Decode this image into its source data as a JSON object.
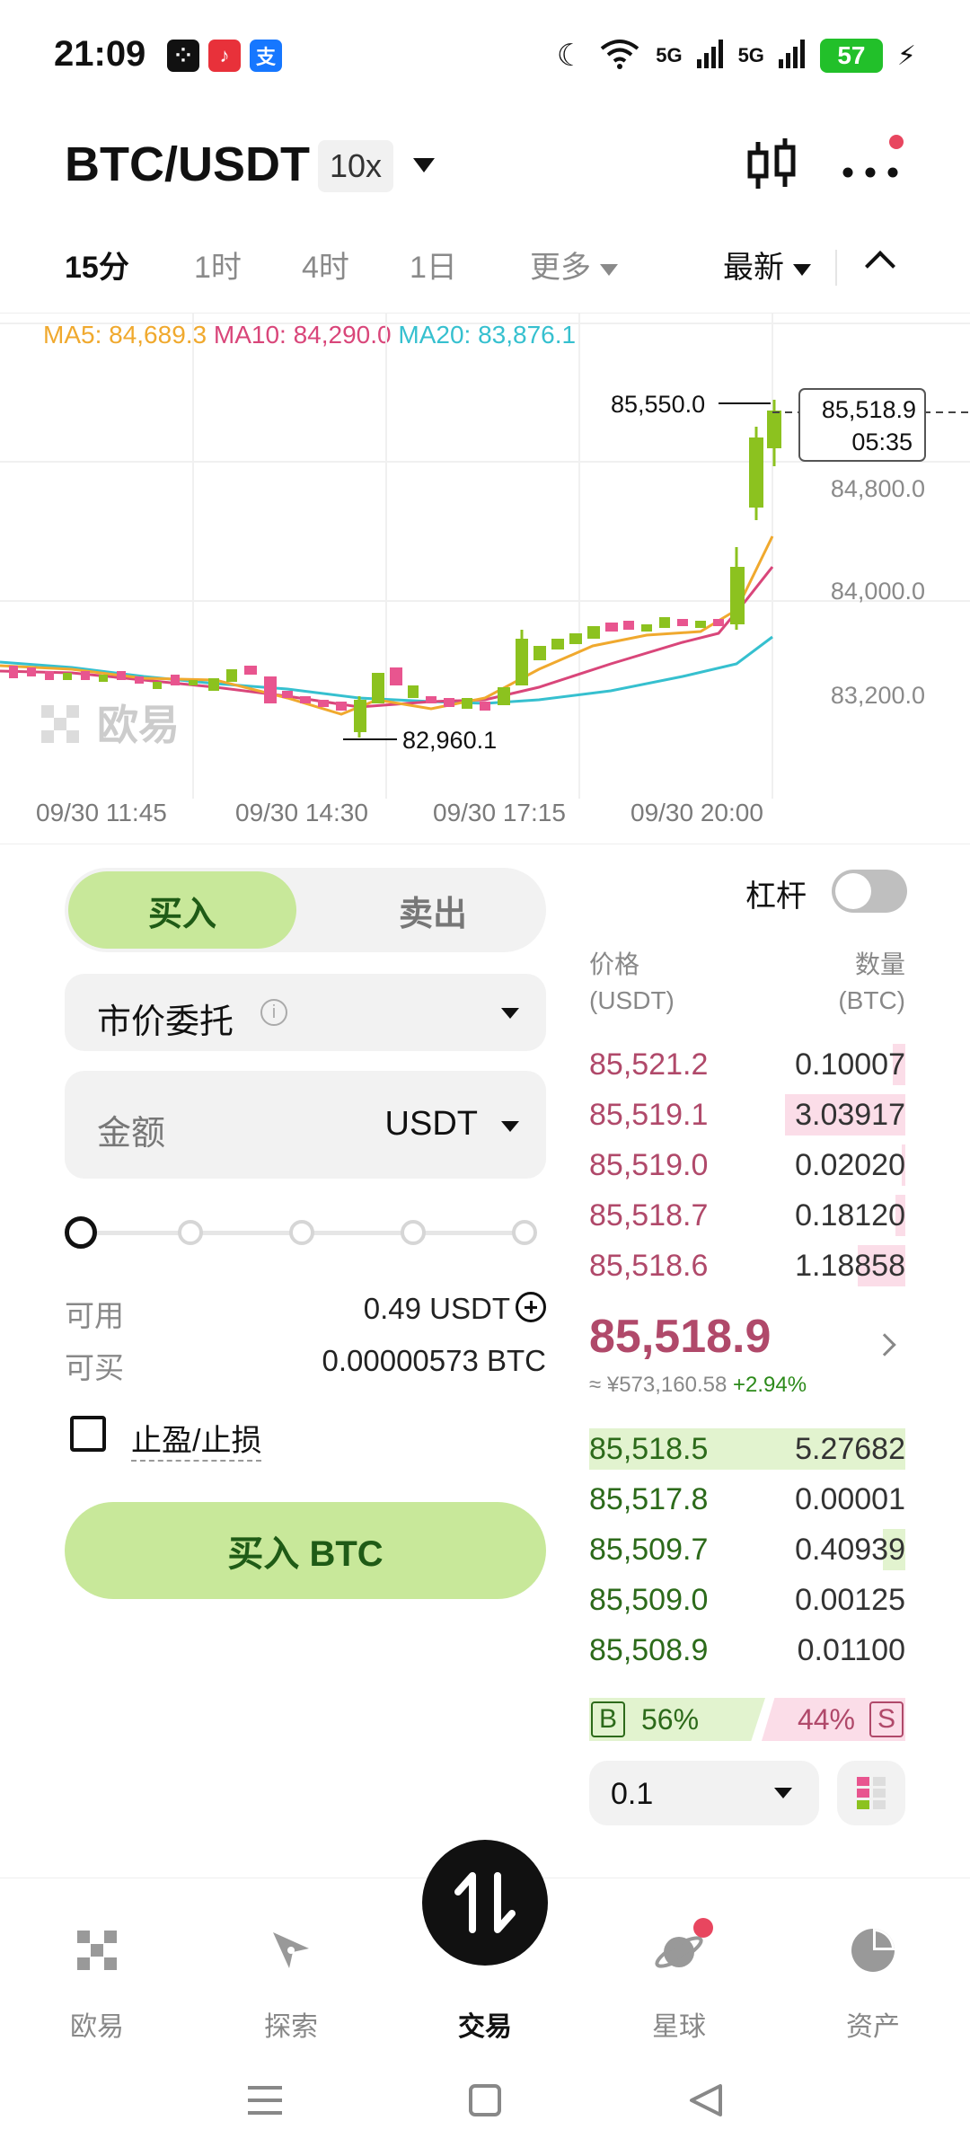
{
  "status_bar": {
    "time": "21:09",
    "battery": "57",
    "signal_1": "5G",
    "signal_2": "5G"
  },
  "header": {
    "pair": "BTC/USDT",
    "leverage": "10x"
  },
  "interval_tabs": [
    {
      "label": "15分",
      "active": true
    },
    {
      "label": "1时",
      "active": false
    },
    {
      "label": "4时",
      "active": false
    },
    {
      "label": "1日",
      "active": false
    },
    {
      "label": "更多",
      "active": false
    }
  ],
  "sort_label": "最新",
  "chart": {
    "ma5": "MA5: 84,689.3",
    "ma10": "MA10: 84,290.0",
    "ma20": "MA20: 83,876.1",
    "high_label": "85,550.0",
    "low_label": "82,960.1",
    "current_price": "85,518.9",
    "countdown": "05:35",
    "y_ticks": [
      "84,800.0",
      "84,000.0",
      "83,200.0"
    ],
    "x_ticks": [
      "09/30 11:45",
      "09/30 14:30",
      "09/30 17:15",
      "09/30 20:00"
    ],
    "watermark": "欧易",
    "colors": {
      "up": "#8cc21f",
      "down": "#e8558f"
    }
  },
  "chart_data": {
    "type": "candlestick",
    "series": [
      {
        "name": "MA5",
        "value": 84689.3
      },
      {
        "name": "MA10",
        "value": 84290.0
      },
      {
        "name": "MA20",
        "value": 83876.1
      }
    ],
    "high": 85550.0,
    "low": 82960.1,
    "last": 85518.9,
    "y_ticks": [
      84800.0,
      84000.0,
      83200.0
    ],
    "x_ticks": [
      "09/30 11:45",
      "09/30 14:30",
      "09/30 17:15",
      "09/30 20:00"
    ]
  },
  "trade": {
    "buy_tab": "买入",
    "sell_tab": "卖出",
    "order_type": "市价委托",
    "amount_placeholder": "金额",
    "amount_currency": "USDT",
    "available_label": "可用",
    "available_value": "0.49 USDT",
    "can_buy_label": "可买",
    "can_buy_value": "0.00000573 BTC",
    "tp_sl_label": "止盈/止损",
    "buy_button": "买入 BTC"
  },
  "orderbook": {
    "leverage_label": "杠杆",
    "price_header": "价格",
    "price_unit": "(USDT)",
    "qty_header": "数量",
    "qty_unit": "(BTC)",
    "asks": [
      {
        "price": "85,521.2",
        "qty": "0.10007",
        "depth": 0.04
      },
      {
        "price": "85,519.1",
        "qty": "3.03917",
        "depth": 0.38
      },
      {
        "price": "85,519.0",
        "qty": "0.02020",
        "depth": 0.01
      },
      {
        "price": "85,518.7",
        "qty": "0.18120",
        "depth": 0.03
      },
      {
        "price": "85,518.6",
        "qty": "1.18858",
        "depth": 0.15
      }
    ],
    "last_price": "85,518.9",
    "last_cny": "≈ ¥573,160.58",
    "change": "+2.94%",
    "bids": [
      {
        "price": "85,518.5",
        "qty": "5.27682",
        "depth": 1.0
      },
      {
        "price": "85,517.8",
        "qty": "0.00001",
        "depth": 0.0
      },
      {
        "price": "85,509.7",
        "qty": "0.40939",
        "depth": 0.07
      },
      {
        "price": "85,509.0",
        "qty": "0.00125",
        "depth": 0.0
      },
      {
        "price": "85,508.9",
        "qty": "0.01100",
        "depth": 0.0
      }
    ],
    "buy_badge": "B",
    "buy_pct": "56%",
    "sell_pct": "44%",
    "sell_badge": "S",
    "depth_step": "0.1"
  },
  "bottom_nav": [
    {
      "label": "欧易",
      "icon": "okx-logo-icon"
    },
    {
      "label": "探索",
      "icon": "compass-icon"
    },
    {
      "label": "交易",
      "icon": "trade-swap-icon"
    },
    {
      "label": "星球",
      "icon": "planet-icon"
    },
    {
      "label": "资产",
      "icon": "pie-chart-icon"
    }
  ]
}
